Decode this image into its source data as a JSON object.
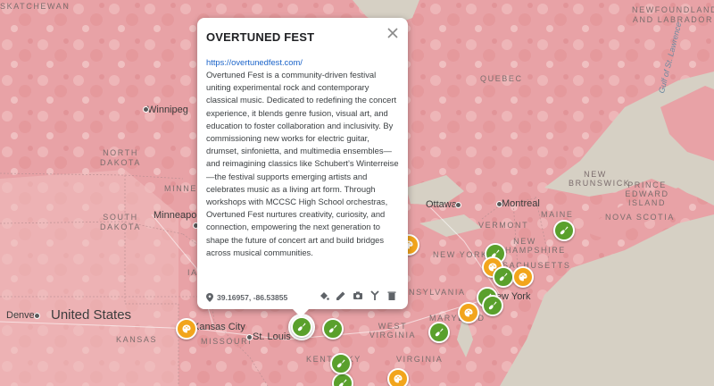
{
  "map": {
    "labels": {
      "saskatchewan": "SKATCHEWAN",
      "winnipeg": "Winnipeg",
      "north_dakota": "NORTH DAKOTA",
      "south_dakota": "SOUTH DAKOTA",
      "minnesota": "MINNESO",
      "minneapolis": "Minneapolis",
      "denver": "Denver",
      "united_states": "United States",
      "kansas": "KANSAS",
      "kansas_city": "Kansas City",
      "missouri": "MISSOURI",
      "st_louis": "St. Louis",
      "kentucky": "KENTUCKY",
      "virginia": "VIRGINIA",
      "west_virginia": "WEST VIRGINIA",
      "maryland": "MARYLAND",
      "pennsylvania": "NSYLVANIA",
      "new_york_state": "NEW YORK",
      "new_york_city": "New York",
      "massachusetts": "SACHUSETTS",
      "new_hampshire": "NEW HAMPSHIRE",
      "vermont": "VERMONT",
      "maine": "MAINE",
      "ottawa": "Ottawa",
      "montreal": "Montreal",
      "quebec": "QUEBEC",
      "new_brunswick": "NEW BRUNSWICK",
      "pei": "PRINCE EDWARD ISLAND",
      "nova_scotia": "NOVA SCOTIA",
      "newfoundland": "NEWFOUNDLAND AND LABRADOR",
      "gulf": "Gulf of St. Lawrence",
      "ia_partial": "IA",
      "ia_partial2": "IA"
    },
    "markers": [
      {
        "color": "green",
        "icon": "guitar-icon"
      },
      {
        "color": "green",
        "icon": "guitar-icon"
      },
      {
        "color": "orange",
        "icon": "palette-icon"
      },
      {
        "color": "green",
        "icon": "guitar-icon"
      },
      {
        "color": "orange",
        "icon": "palette-icon"
      },
      {
        "color": "green",
        "icon": "guitar-icon"
      },
      {
        "color": "orange",
        "icon": "palette-icon"
      },
      {
        "color": "green",
        "icon": "guitar-icon"
      },
      {
        "color": "orange",
        "icon": "palette-icon"
      },
      {
        "color": "orange",
        "icon": "palette-icon"
      },
      {
        "color": "green",
        "icon": "guitar-icon"
      },
      {
        "color": "orange",
        "icon": "palette-icon"
      },
      {
        "color": "green",
        "icon": "guitar-icon"
      },
      {
        "color": "green",
        "icon": "guitar-icon"
      },
      {
        "color": "green",
        "icon": "guitar-icon"
      }
    ],
    "selected_marker": {
      "color": "green",
      "icon": "guitar-icon"
    },
    "colors": {
      "land": "#e8a6a8",
      "land_light": "#f0c4c4",
      "water": "#d0ccc0",
      "green_marker": "#5aa02c",
      "orange_marker": "#f2a51c"
    }
  },
  "popup": {
    "title": "OVERTUNED FEST",
    "link": "https://overtunedfest.com/",
    "description": "Overtuned Fest is a community-driven festival uniting experimental rock and contemporary classical music. Dedicated to redefining the concert experience, it blends genre fusion, visual art, and education to foster collaboration and inclusivity. By commissioning new works for electric guitar, drumset, sinfonietta, and multimedia ensembles—and reimagining classics like Schubert’s Winterreise—the festival supports emerging artists and celebrates music as a living art form. Through workshops with MCCSC High School orchestras, Overtuned Fest nurtures creativity, curiosity, and connection, empowering the next generation to shape the future of concert art and build bridges across musical communities.",
    "coordinates": "39.16957, -86.53855",
    "tools": [
      "paint-bucket-icon",
      "pencil-icon",
      "camera-icon",
      "route-icon",
      "trash-icon"
    ]
  }
}
